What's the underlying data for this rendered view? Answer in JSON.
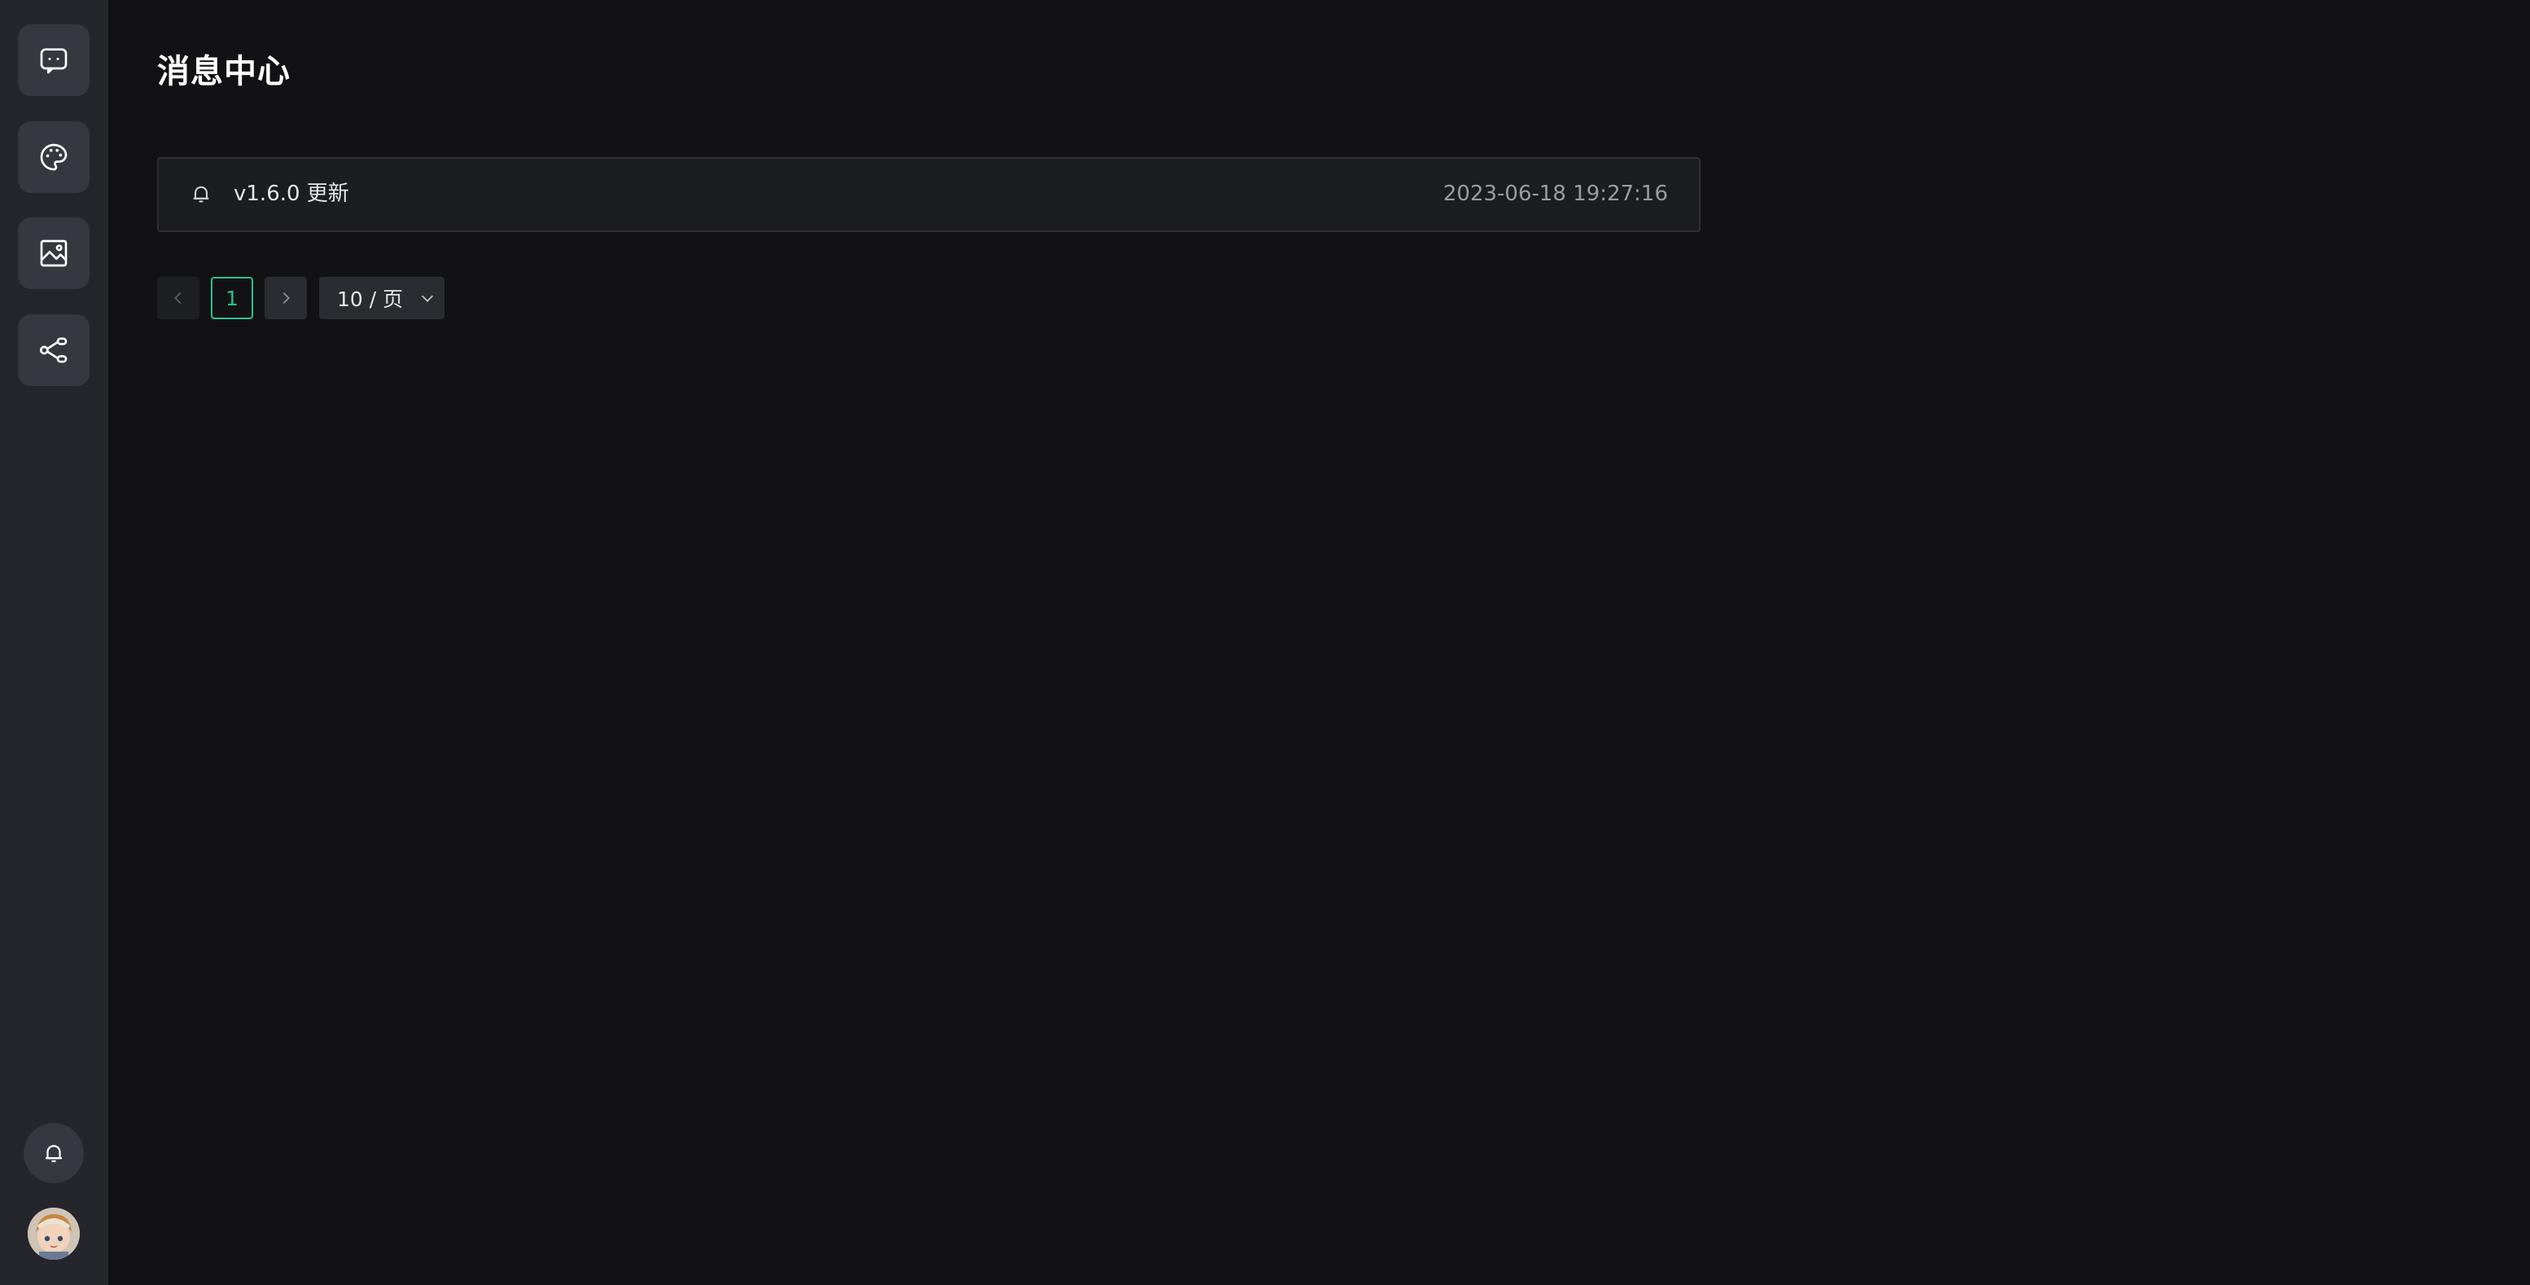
{
  "sidebar": {
    "items": [
      {
        "name": "chat",
        "icon": "chat-bubble-icon"
      },
      {
        "name": "palette",
        "icon": "palette-icon"
      },
      {
        "name": "image",
        "icon": "image-icon"
      },
      {
        "name": "share",
        "icon": "share-nodes-icon"
      }
    ],
    "notifications_icon": "bell-icon",
    "avatar_icon": "user-avatar"
  },
  "page": {
    "title": "消息中心"
  },
  "messages": [
    {
      "title": "v1.6.0 更新",
      "time": "2023-06-18 19:27:16",
      "icon": "bell-icon"
    }
  ],
  "pagination": {
    "current_page": "1",
    "page_size": "10 / 页",
    "prev_icon": "chevron-left-icon",
    "next_icon": "chevron-right-icon",
    "dropdown_icon": "chevron-down-icon"
  },
  "colors": {
    "background": "#121214",
    "sidebar": "#24262c",
    "accent": "#27c28f",
    "card": "#1c1d20"
  }
}
